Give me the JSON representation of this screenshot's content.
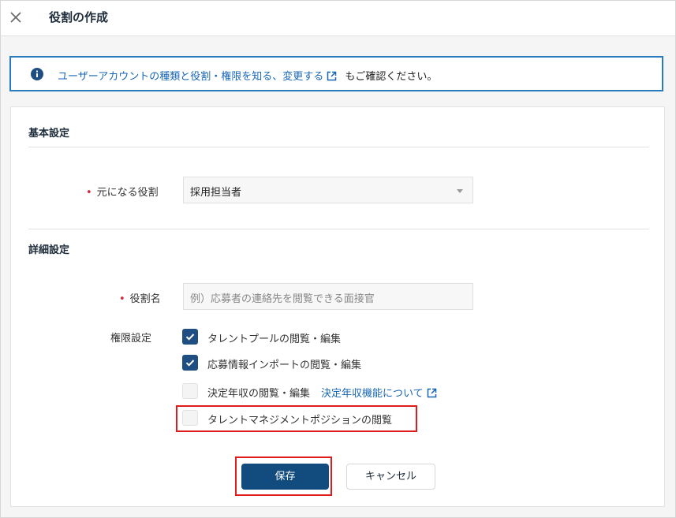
{
  "header": {
    "close_icon": "close-icon",
    "title": "役割の作成"
  },
  "info": {
    "icon": "info-icon",
    "link_text": "ユーザーアカウントの種類と役割・権限を知る、変更する",
    "suffix_text": "もご確認ください。"
  },
  "basic": {
    "title": "基本設定",
    "base_role_label": "元になる役割",
    "base_role_value": "採用担当者"
  },
  "detail": {
    "title": "詳細設定",
    "role_name_label": "役割名",
    "role_name_placeholder": "例）応募者の連絡先を閲覧できる面接官",
    "permissions_label": "権限設定",
    "permissions": [
      {
        "label": "タレントプールの閲覧・編集",
        "checked": true
      },
      {
        "label": "応募情報インポートの閲覧・編集",
        "checked": true
      },
      {
        "label": "決定年収の閲覧・編集",
        "checked": false,
        "link": "決定年収機能について"
      },
      {
        "label": "タレントマネジメントポジションの閲覧",
        "checked": false
      }
    ]
  },
  "buttons": {
    "save": "保存",
    "cancel": "キャンセル"
  },
  "colors": {
    "primary": "#124b7d",
    "link": "#1766b5",
    "required": "#d9263b",
    "highlight": "#e01b1b",
    "info_border": "#2a7bbd"
  }
}
